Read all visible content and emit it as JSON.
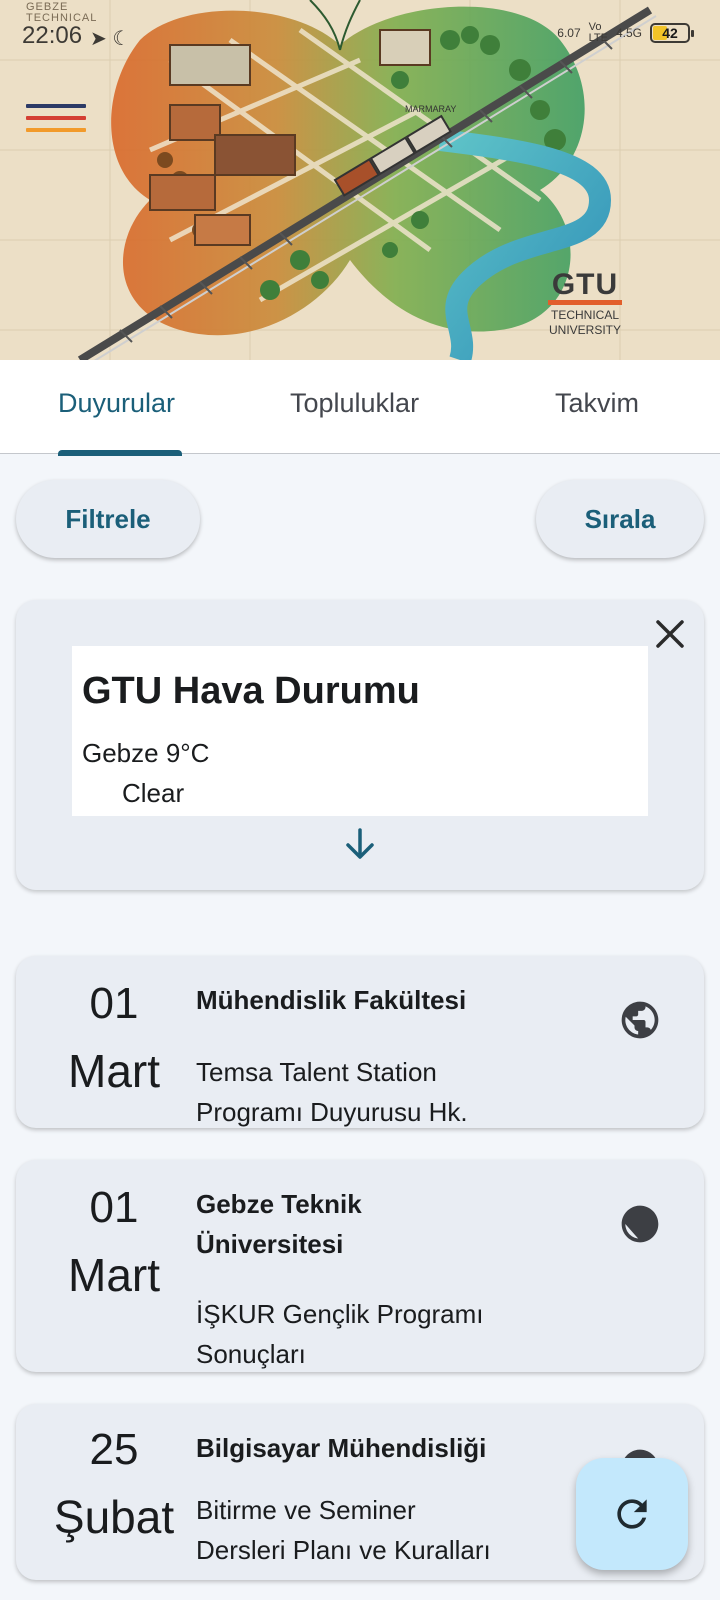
{
  "status_bar": {
    "brand_line1": "GEBZE",
    "brand_line2": "TECHNICAL",
    "time": "22:06",
    "icons": "➤ ☾",
    "net_line1": "Vo",
    "net_line2": "LTE",
    "net_speed": "6.07",
    "signal": "4.5G",
    "battery": "42"
  },
  "header": {
    "map_label": "MARMARAY",
    "logo_main": "GTU",
    "logo_line1": "TECHNICAL",
    "logo_line2": "UNIVERSITY"
  },
  "tabs": [
    {
      "label": "Duyurular",
      "active": true
    },
    {
      "label": "Topluluklar",
      "active": false
    },
    {
      "label": "Takvim",
      "active": false
    }
  ],
  "actions": {
    "filter_label": "Filtrele",
    "sort_label": "Sırala"
  },
  "weather": {
    "title": "GTU Hava Durumu",
    "city_temp": "Gebze 9°C",
    "condition": "Clear"
  },
  "announcements": [
    {
      "day": "01",
      "month": "Mart",
      "source": "Mühendislik Fakültesi",
      "title_line1": "Temsa Talent Station",
      "title_line2": "Programı Duyurusu Hk."
    },
    {
      "day": "01",
      "month": "Mart",
      "source_line1": "Gebze Teknik",
      "source_line2": "Üniversitesi",
      "title_line1": "İŞKUR Gençlik Programı",
      "title_line2": "Sonuçları"
    },
    {
      "day": "25",
      "month": "Şubat",
      "source": "Bilgisayar Mühendisliği",
      "title_line1": "Bitirme ve Seminer",
      "title_line2": "Dersleri Planı ve Kuralları"
    }
  ],
  "icons": {
    "menu": "hamburger-icon",
    "close": "close-icon",
    "expand": "arrow-down-icon",
    "link": "globe-icon",
    "refresh": "refresh-icon"
  },
  "colors": {
    "accent": "#1b5f79",
    "fab": "#c3e8fc",
    "card": "#e9edf3",
    "background": "#f3f6fa"
  }
}
